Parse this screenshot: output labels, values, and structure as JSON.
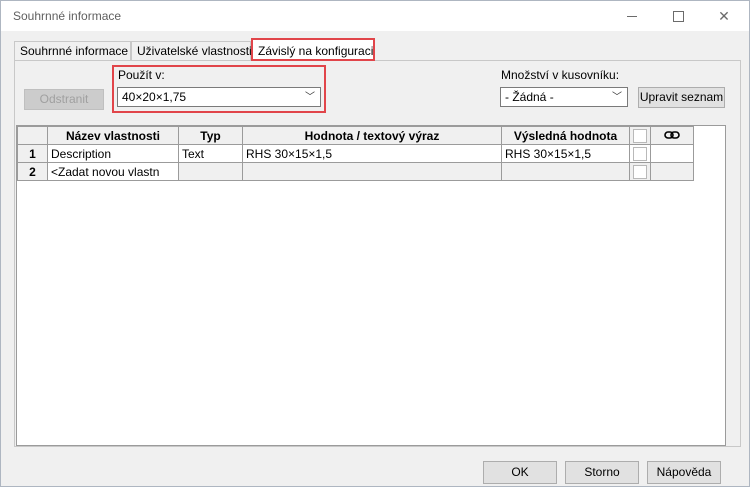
{
  "window": {
    "title": "Souhrnné informace"
  },
  "tabs": [
    {
      "label": "Souhrnné informace"
    },
    {
      "label": "Uživatelské vlastnosti"
    },
    {
      "label": "Závislý na konfiguraci"
    }
  ],
  "left": {
    "remove_button": "Odstranit",
    "used_in_label": "Použít v:",
    "used_in_value": "40×20×1,75"
  },
  "right": {
    "bom_qty_label": "Množství v kusovníku:",
    "bom_qty_value": "- Žádná -",
    "edit_list_button": "Upravit seznam"
  },
  "table": {
    "headers": {
      "name": "Název vlastnosti",
      "type": "Typ",
      "value": "Hodnota / textový výraz",
      "result": "Výsledná hodnota"
    },
    "rows": [
      {
        "num": "1",
        "name": "Description",
        "type": "Text",
        "value": "RHS 30×15×1,5",
        "result": "RHS 30×15×1,5"
      },
      {
        "num": "2",
        "name": "<Zadat novou vlastn",
        "type": "",
        "value": "",
        "result": ""
      }
    ]
  },
  "footer": {
    "ok": "OK",
    "cancel": "Storno",
    "help": "Nápověda"
  },
  "colors": {
    "highlight": "#e1454a"
  }
}
